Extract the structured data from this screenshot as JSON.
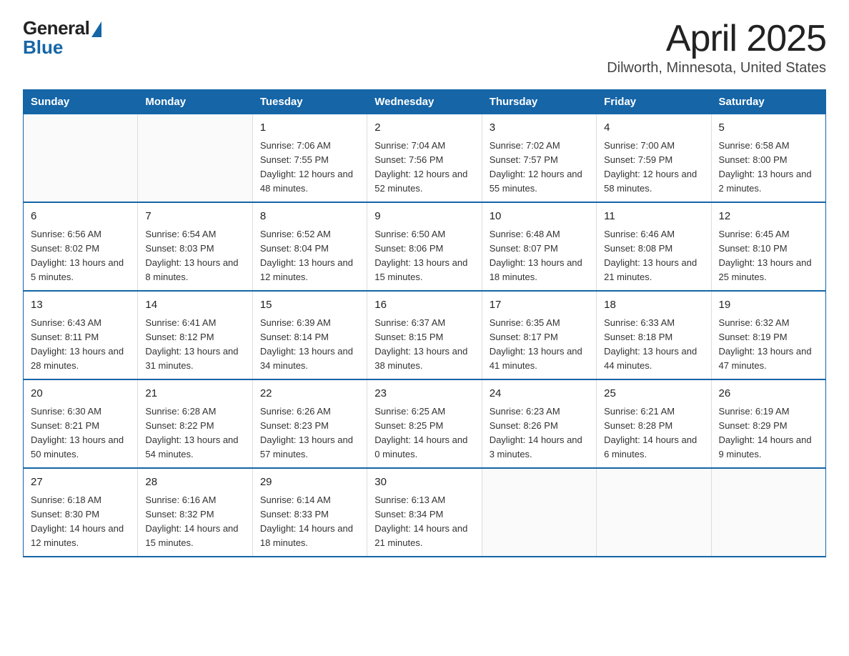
{
  "logo": {
    "general": "General",
    "blue": "Blue"
  },
  "title": "April 2025",
  "subtitle": "Dilworth, Minnesota, United States",
  "days_of_week": [
    "Sunday",
    "Monday",
    "Tuesday",
    "Wednesday",
    "Thursday",
    "Friday",
    "Saturday"
  ],
  "weeks": [
    [
      {
        "day": "",
        "sunrise": "",
        "sunset": "",
        "daylight": ""
      },
      {
        "day": "",
        "sunrise": "",
        "sunset": "",
        "daylight": ""
      },
      {
        "day": "1",
        "sunrise": "Sunrise: 7:06 AM",
        "sunset": "Sunset: 7:55 PM",
        "daylight": "Daylight: 12 hours and 48 minutes."
      },
      {
        "day": "2",
        "sunrise": "Sunrise: 7:04 AM",
        "sunset": "Sunset: 7:56 PM",
        "daylight": "Daylight: 12 hours and 52 minutes."
      },
      {
        "day": "3",
        "sunrise": "Sunrise: 7:02 AM",
        "sunset": "Sunset: 7:57 PM",
        "daylight": "Daylight: 12 hours and 55 minutes."
      },
      {
        "day": "4",
        "sunrise": "Sunrise: 7:00 AM",
        "sunset": "Sunset: 7:59 PM",
        "daylight": "Daylight: 12 hours and 58 minutes."
      },
      {
        "day": "5",
        "sunrise": "Sunrise: 6:58 AM",
        "sunset": "Sunset: 8:00 PM",
        "daylight": "Daylight: 13 hours and 2 minutes."
      }
    ],
    [
      {
        "day": "6",
        "sunrise": "Sunrise: 6:56 AM",
        "sunset": "Sunset: 8:02 PM",
        "daylight": "Daylight: 13 hours and 5 minutes."
      },
      {
        "day": "7",
        "sunrise": "Sunrise: 6:54 AM",
        "sunset": "Sunset: 8:03 PM",
        "daylight": "Daylight: 13 hours and 8 minutes."
      },
      {
        "day": "8",
        "sunrise": "Sunrise: 6:52 AM",
        "sunset": "Sunset: 8:04 PM",
        "daylight": "Daylight: 13 hours and 12 minutes."
      },
      {
        "day": "9",
        "sunrise": "Sunrise: 6:50 AM",
        "sunset": "Sunset: 8:06 PM",
        "daylight": "Daylight: 13 hours and 15 minutes."
      },
      {
        "day": "10",
        "sunrise": "Sunrise: 6:48 AM",
        "sunset": "Sunset: 8:07 PM",
        "daylight": "Daylight: 13 hours and 18 minutes."
      },
      {
        "day": "11",
        "sunrise": "Sunrise: 6:46 AM",
        "sunset": "Sunset: 8:08 PM",
        "daylight": "Daylight: 13 hours and 21 minutes."
      },
      {
        "day": "12",
        "sunrise": "Sunrise: 6:45 AM",
        "sunset": "Sunset: 8:10 PM",
        "daylight": "Daylight: 13 hours and 25 minutes."
      }
    ],
    [
      {
        "day": "13",
        "sunrise": "Sunrise: 6:43 AM",
        "sunset": "Sunset: 8:11 PM",
        "daylight": "Daylight: 13 hours and 28 minutes."
      },
      {
        "day": "14",
        "sunrise": "Sunrise: 6:41 AM",
        "sunset": "Sunset: 8:12 PM",
        "daylight": "Daylight: 13 hours and 31 minutes."
      },
      {
        "day": "15",
        "sunrise": "Sunrise: 6:39 AM",
        "sunset": "Sunset: 8:14 PM",
        "daylight": "Daylight: 13 hours and 34 minutes."
      },
      {
        "day": "16",
        "sunrise": "Sunrise: 6:37 AM",
        "sunset": "Sunset: 8:15 PM",
        "daylight": "Daylight: 13 hours and 38 minutes."
      },
      {
        "day": "17",
        "sunrise": "Sunrise: 6:35 AM",
        "sunset": "Sunset: 8:17 PM",
        "daylight": "Daylight: 13 hours and 41 minutes."
      },
      {
        "day": "18",
        "sunrise": "Sunrise: 6:33 AM",
        "sunset": "Sunset: 8:18 PM",
        "daylight": "Daylight: 13 hours and 44 minutes."
      },
      {
        "day": "19",
        "sunrise": "Sunrise: 6:32 AM",
        "sunset": "Sunset: 8:19 PM",
        "daylight": "Daylight: 13 hours and 47 minutes."
      }
    ],
    [
      {
        "day": "20",
        "sunrise": "Sunrise: 6:30 AM",
        "sunset": "Sunset: 8:21 PM",
        "daylight": "Daylight: 13 hours and 50 minutes."
      },
      {
        "day": "21",
        "sunrise": "Sunrise: 6:28 AM",
        "sunset": "Sunset: 8:22 PM",
        "daylight": "Daylight: 13 hours and 54 minutes."
      },
      {
        "day": "22",
        "sunrise": "Sunrise: 6:26 AM",
        "sunset": "Sunset: 8:23 PM",
        "daylight": "Daylight: 13 hours and 57 minutes."
      },
      {
        "day": "23",
        "sunrise": "Sunrise: 6:25 AM",
        "sunset": "Sunset: 8:25 PM",
        "daylight": "Daylight: 14 hours and 0 minutes."
      },
      {
        "day": "24",
        "sunrise": "Sunrise: 6:23 AM",
        "sunset": "Sunset: 8:26 PM",
        "daylight": "Daylight: 14 hours and 3 minutes."
      },
      {
        "day": "25",
        "sunrise": "Sunrise: 6:21 AM",
        "sunset": "Sunset: 8:28 PM",
        "daylight": "Daylight: 14 hours and 6 minutes."
      },
      {
        "day": "26",
        "sunrise": "Sunrise: 6:19 AM",
        "sunset": "Sunset: 8:29 PM",
        "daylight": "Daylight: 14 hours and 9 minutes."
      }
    ],
    [
      {
        "day": "27",
        "sunrise": "Sunrise: 6:18 AM",
        "sunset": "Sunset: 8:30 PM",
        "daylight": "Daylight: 14 hours and 12 minutes."
      },
      {
        "day": "28",
        "sunrise": "Sunrise: 6:16 AM",
        "sunset": "Sunset: 8:32 PM",
        "daylight": "Daylight: 14 hours and 15 minutes."
      },
      {
        "day": "29",
        "sunrise": "Sunrise: 6:14 AM",
        "sunset": "Sunset: 8:33 PM",
        "daylight": "Daylight: 14 hours and 18 minutes."
      },
      {
        "day": "30",
        "sunrise": "Sunrise: 6:13 AM",
        "sunset": "Sunset: 8:34 PM",
        "daylight": "Daylight: 14 hours and 21 minutes."
      },
      {
        "day": "",
        "sunrise": "",
        "sunset": "",
        "daylight": ""
      },
      {
        "day": "",
        "sunrise": "",
        "sunset": "",
        "daylight": ""
      },
      {
        "day": "",
        "sunrise": "",
        "sunset": "",
        "daylight": ""
      }
    ]
  ]
}
